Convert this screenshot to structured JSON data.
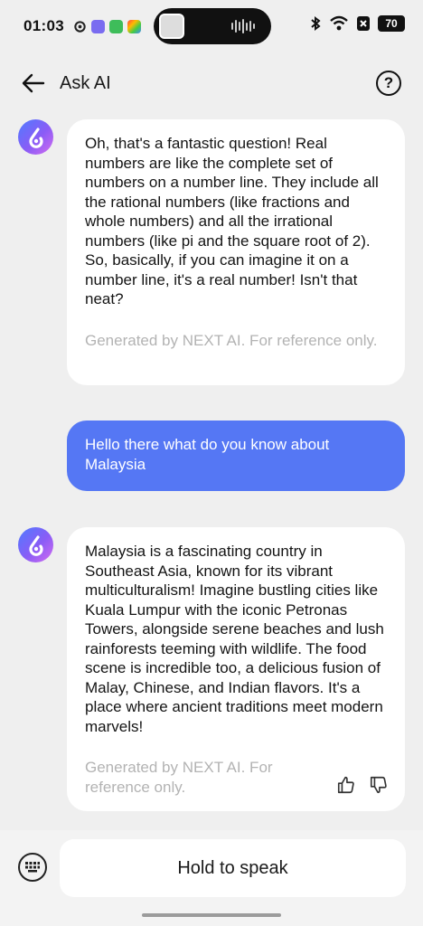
{
  "status_bar": {
    "time": "01:03",
    "battery": "70"
  },
  "header": {
    "title": "Ask AI",
    "back_icon": "arrow-left-icon",
    "help_icon": "question-circle-icon"
  },
  "messages": [
    {
      "role": "ai",
      "text": "Oh, that's a fantastic question! Real numbers are like the complete set of numbers on a number line. They include all the rational numbers (like fractions and whole numbers) and all the irrational numbers (like pi and the square root of 2). So, basically, if you can imagine it on a number line, it's a real number! Isn't that neat?",
      "disclaimer": "Generated by NEXT AI. For reference only."
    },
    {
      "role": "user",
      "text": "Hello there what do you know about Malaysia"
    },
    {
      "role": "ai",
      "text": "Malaysia is a fascinating country in Southeast Asia, known for its vibrant multiculturalism! Imagine bustling cities like Kuala Lumpur with the iconic Petronas Towers, alongside serene beaches and lush rainforests teeming with wildlife. The food scene is incredible too, a delicious fusion of Malay, Chinese, and Indian flavors. It's a place where ancient traditions meet modern marvels!",
      "disclaimer": "Generated by NEXT AI. For reference only."
    }
  ],
  "input_bar": {
    "speak_label": "Hold to speak",
    "keyboard_icon": "keyboard-icon"
  },
  "colors": {
    "user_bubble": "#5577f4",
    "background": "#efefef"
  }
}
